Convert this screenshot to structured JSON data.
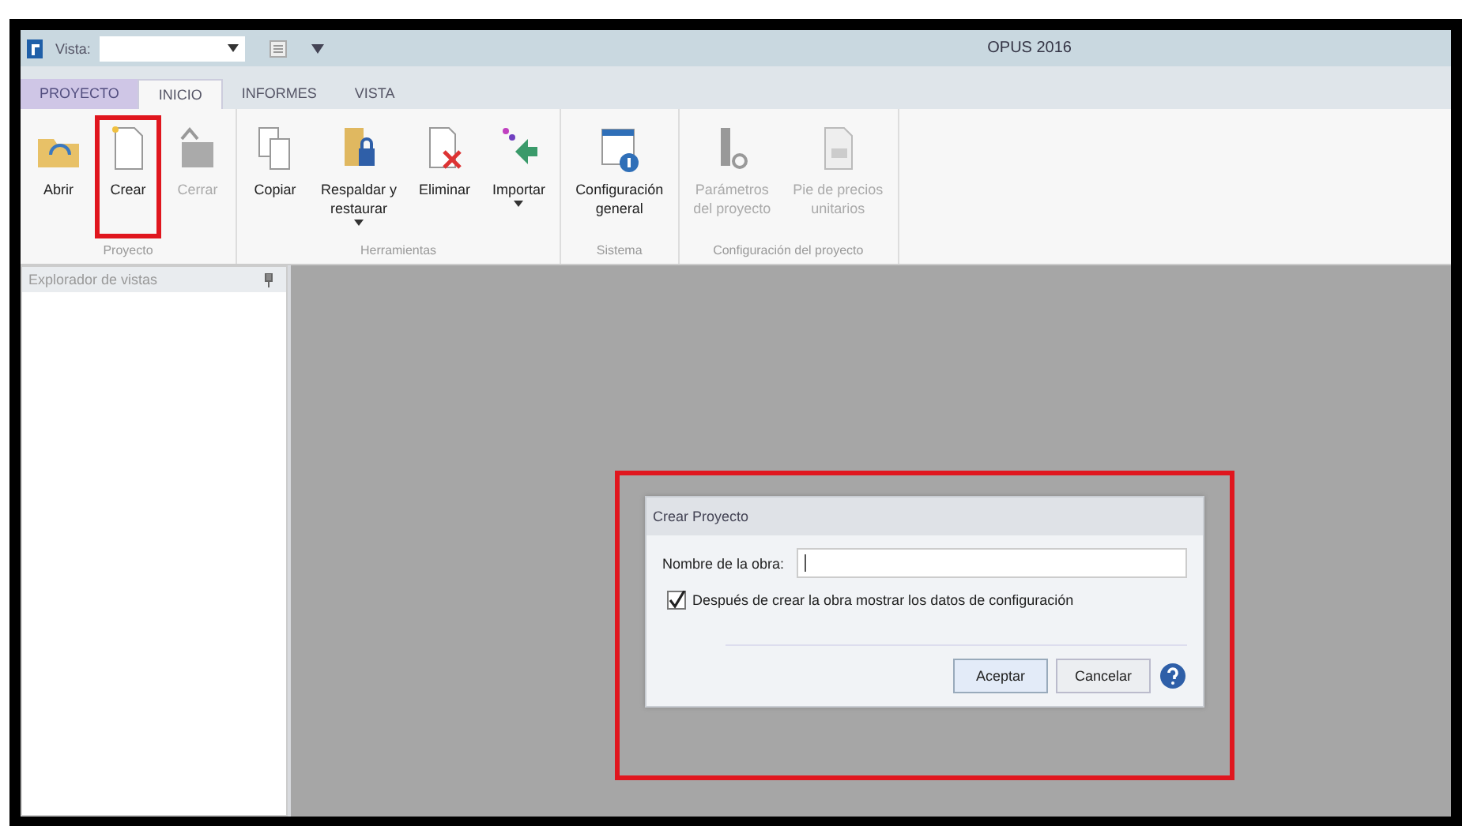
{
  "title_bar": {
    "view_label": "Vista:",
    "app_title": "OPUS 2016"
  },
  "tabs": [
    {
      "label": "PROYECTO",
      "selected": false,
      "kind": "app"
    },
    {
      "label": "INICIO",
      "selected": true,
      "kind": "tab"
    },
    {
      "label": "INFORMES",
      "selected": false,
      "kind": "tab"
    },
    {
      "label": "VISTA",
      "selected": false,
      "kind": "tab"
    }
  ],
  "ribbon_groups": [
    {
      "label": "Proyecto",
      "buttons": [
        {
          "label": "Abrir",
          "kind": "folder",
          "disabled": false,
          "dropdown": false,
          "highlighted": false
        },
        {
          "label": "Crear",
          "kind": "new",
          "disabled": false,
          "dropdown": false,
          "highlighted": true
        },
        {
          "label": "Cerrar",
          "kind": "close",
          "disabled": true,
          "dropdown": false,
          "highlighted": false
        }
      ]
    },
    {
      "label": "Herramientas",
      "buttons": [
        {
          "label": "Copiar",
          "kind": "copy",
          "disabled": false,
          "dropdown": false,
          "highlighted": false
        },
        {
          "label": "Respaldar y\nrestaurar",
          "kind": "backup",
          "disabled": false,
          "dropdown": true,
          "highlighted": false
        },
        {
          "label": "Eliminar",
          "kind": "delete",
          "disabled": false,
          "dropdown": false,
          "highlighted": false
        },
        {
          "label": "Importar",
          "kind": "import",
          "disabled": false,
          "dropdown": true,
          "highlighted": false
        }
      ]
    },
    {
      "label": "Sistema",
      "buttons": [
        {
          "label": "Configuración\ngeneral",
          "kind": "config",
          "disabled": false,
          "dropdown": false,
          "highlighted": false
        }
      ]
    },
    {
      "label": "Configuración del proyecto",
      "buttons": [
        {
          "label": "Parámetros\ndel proyecto",
          "kind": "params",
          "disabled": true,
          "dropdown": false,
          "highlighted": false
        },
        {
          "label": "Pie de precios\nunitarios",
          "kind": "sheet",
          "disabled": true,
          "dropdown": false,
          "highlighted": false
        }
      ]
    }
  ],
  "sidebar": {
    "title": "Explorador de vistas"
  },
  "dialog": {
    "title": "Crear Proyecto",
    "highlighted": true,
    "name_label": "Nombre de la obra:",
    "checkbox": {
      "label": "Después de crear la obra mostrar los datos de configuración",
      "checked": true
    },
    "buttons": [
      {
        "label": "Aceptar",
        "default": true
      },
      {
        "label": "Cancelar",
        "default": false
      }
    ]
  }
}
